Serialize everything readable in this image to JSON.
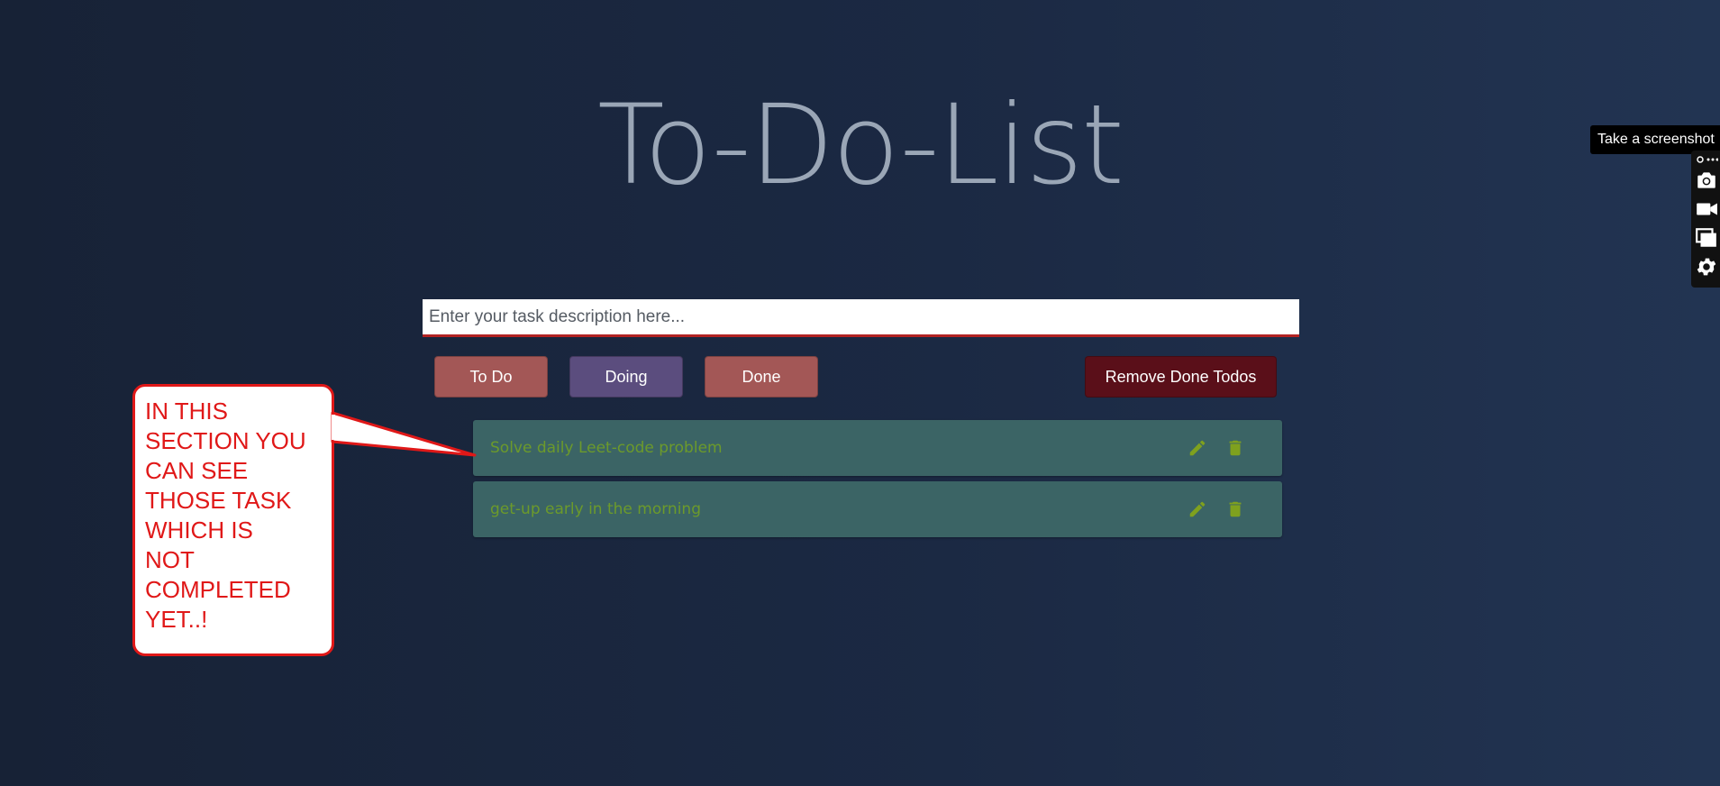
{
  "page": {
    "title": "To-Do-List"
  },
  "form": {
    "task_placeholder": "Enter your task description here...",
    "task_value": ""
  },
  "filters": {
    "todo_label": "To Do",
    "doing_label": "Doing",
    "done_label": "Done",
    "remove_done_label": "Remove Done Todos"
  },
  "todos": [
    {
      "text": "Solve daily Leet-code problem",
      "edit_icon": "pencil-icon",
      "delete_icon": "trash-icon"
    },
    {
      "text": "get-up early in the morning",
      "edit_icon": "pencil-icon",
      "delete_icon": "trash-icon"
    }
  ],
  "annotation": {
    "text": "IN THIS\nSECTION YOU\nCAN SEE\nTHOSE TASK\nWHICH IS\nNOT\nCOMPLETED\nYET..!"
  },
  "screenshot_toolbar": {
    "tooltip": "Take a screenshot",
    "icons": [
      "more-icon",
      "camera-icon",
      "video-icon",
      "window-icon",
      "gear-icon"
    ]
  },
  "colors": {
    "todo_button": "#a35756",
    "doing_button": "#5b4d7e",
    "remove_button": "#5a0f19",
    "todo_row": "#3b6465",
    "todo_text": "#6c9a2b",
    "annotation_red": "#e01818"
  }
}
